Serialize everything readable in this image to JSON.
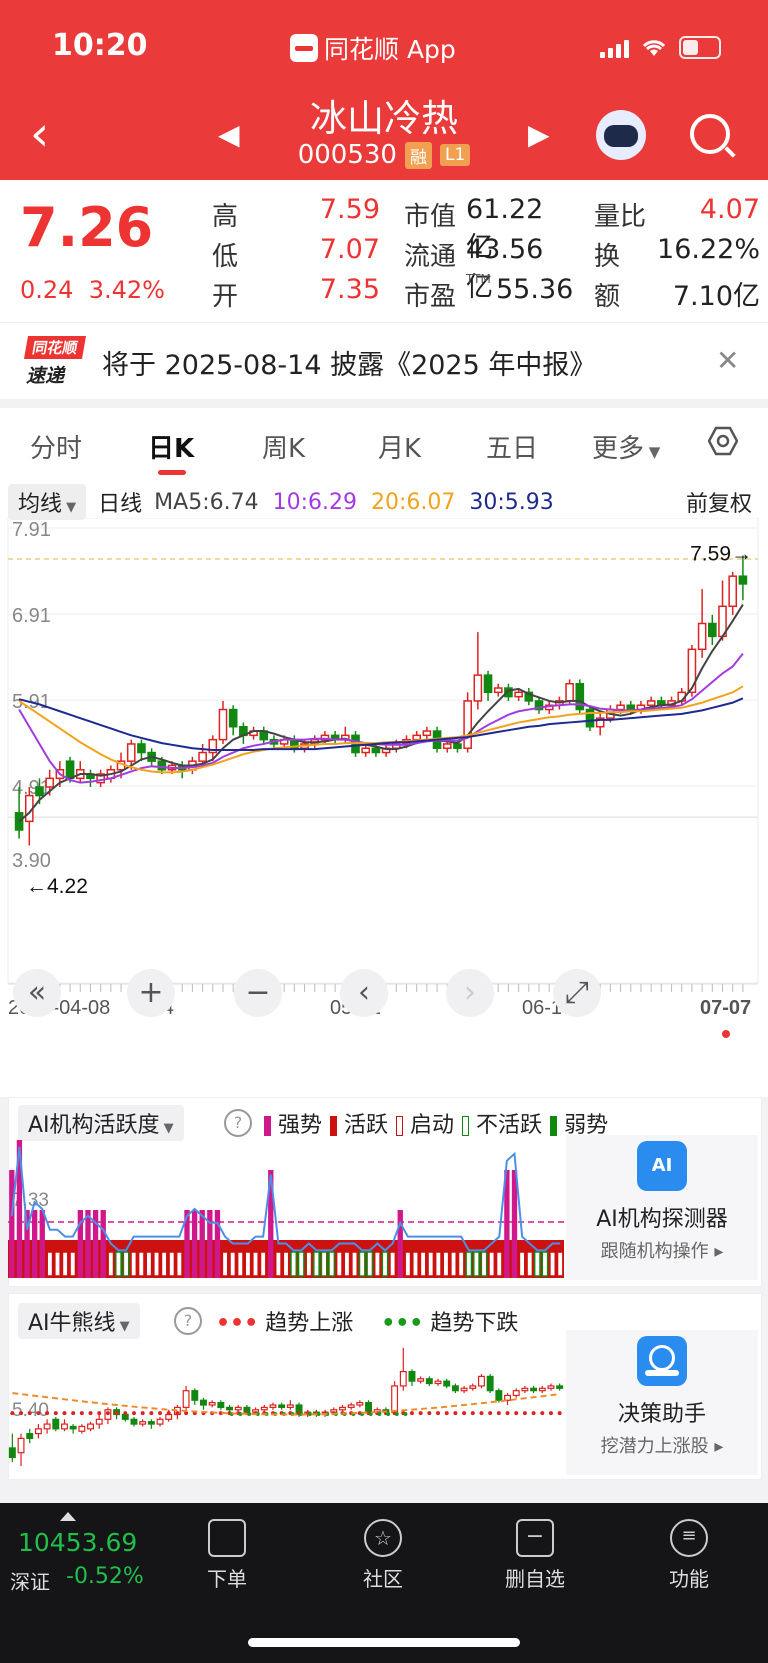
{
  "status_bar": {
    "time": "10:20",
    "app_label": "同花顺 App"
  },
  "header": {
    "name": "冰山冷热",
    "code": "000530",
    "tag_rong": "融",
    "tag_level": "L1"
  },
  "quote": {
    "price": "7.26",
    "change_abs": "0.24",
    "change_pct": "3.42%",
    "high_label": "高",
    "high": "7.59",
    "low_label": "低",
    "low": "7.07",
    "open_label": "开",
    "open": "7.35",
    "mcap_label": "市值",
    "mcap": "61.22亿",
    "float_label": "流通",
    "float": "43.56亿",
    "pe_label": "市盈",
    "pe_sup": "TTM",
    "pe": "55.36",
    "vr_label": "量比",
    "vr": "4.07",
    "turnover_label": "换",
    "turnover": "16.22%",
    "amount_label": "额",
    "amount": "7.10亿"
  },
  "notice": {
    "logo_top": "同花顺",
    "logo_bottom": "速递",
    "text": "将于 2025-08-14 披露《2025 年中报》"
  },
  "tabs": [
    "分时",
    "日K",
    "周K",
    "月K",
    "五日",
    "更多"
  ],
  "ma_row": {
    "select": "均线",
    "period": "日线",
    "ma5": "MA5:6.74",
    "ma10": "10:6.29",
    "ma20": "20:6.07",
    "ma30": "30:5.93",
    "adjust": "前复权"
  },
  "chart_data": {
    "type": "candlestick",
    "y_ticks": [
      "7.91",
      "6.91",
      "5.91",
      "4.91",
      "3.90"
    ],
    "high_marker": "7.59→",
    "low_marker": "←4.22",
    "x_ticks": [
      "2025-04-08",
      "-24",
      "05-21",
      "06-13",
      "07-07"
    ],
    "series": [
      {
        "name": "MA5",
        "color": "#444444"
      },
      {
        "name": "MA10",
        "color": "#a23be0"
      },
      {
        "name": "MA20",
        "color": "#f2a21b"
      },
      {
        "name": "MA30",
        "color": "#1f2a90"
      }
    ],
    "candles": [
      [
        4.6,
        4.4,
        4.9,
        4.3
      ],
      [
        4.5,
        4.8,
        4.9,
        4.22
      ],
      [
        4.9,
        4.8,
        5.0,
        4.7
      ],
      [
        4.9,
        5.0,
        5.1,
        4.8
      ],
      [
        5.0,
        5.1,
        5.2,
        4.9
      ],
      [
        5.2,
        5.0,
        5.25,
        4.95
      ],
      [
        5.0,
        5.1,
        5.2,
        4.95
      ],
      [
        5.05,
        5.0,
        5.1,
        4.9
      ],
      [
        4.95,
        5.05,
        5.1,
        4.9
      ],
      [
        5.0,
        5.1,
        5.15,
        4.95
      ],
      [
        5.1,
        5.2,
        5.3,
        5.0
      ],
      [
        5.2,
        5.4,
        5.45,
        5.1
      ],
      [
        5.4,
        5.3,
        5.45,
        5.2
      ],
      [
        5.3,
        5.2,
        5.35,
        5.15
      ],
      [
        5.2,
        5.1,
        5.25,
        5.05
      ],
      [
        5.1,
        5.15,
        5.2,
        5.05
      ],
      [
        5.15,
        5.1,
        5.2,
        5.0
      ],
      [
        5.1,
        5.2,
        5.25,
        5.05
      ],
      [
        5.2,
        5.3,
        5.4,
        5.15
      ],
      [
        5.3,
        5.45,
        5.5,
        5.2
      ],
      [
        5.45,
        5.8,
        5.9,
        5.4
      ],
      [
        5.8,
        5.6,
        5.85,
        5.5
      ],
      [
        5.6,
        5.5,
        5.65,
        5.4
      ],
      [
        5.5,
        5.55,
        5.6,
        5.45
      ],
      [
        5.55,
        5.45,
        5.6,
        5.4
      ],
      [
        5.45,
        5.4,
        5.5,
        5.35
      ],
      [
        5.4,
        5.45,
        5.5,
        5.35
      ],
      [
        5.45,
        5.35,
        5.5,
        5.3
      ],
      [
        5.35,
        5.4,
        5.45,
        5.3
      ],
      [
        5.4,
        5.45,
        5.5,
        5.35
      ],
      [
        5.45,
        5.5,
        5.55,
        5.4
      ],
      [
        5.5,
        5.45,
        5.55,
        5.4
      ],
      [
        5.45,
        5.5,
        5.6,
        5.4
      ],
      [
        5.5,
        5.3,
        5.55,
        5.25
      ],
      [
        5.3,
        5.35,
        5.4,
        5.25
      ],
      [
        5.35,
        5.3,
        5.4,
        5.25
      ],
      [
        5.3,
        5.35,
        5.4,
        5.25
      ],
      [
        5.35,
        5.4,
        5.45,
        5.3
      ],
      [
        5.4,
        5.45,
        5.5,
        5.35
      ],
      [
        5.45,
        5.5,
        5.55,
        5.4
      ],
      [
        5.5,
        5.55,
        5.6,
        5.45
      ],
      [
        5.55,
        5.35,
        5.6,
        5.3
      ],
      [
        5.35,
        5.4,
        5.45,
        5.3
      ],
      [
        5.4,
        5.35,
        5.45,
        5.3
      ],
      [
        5.35,
        5.9,
        6.0,
        5.3
      ],
      [
        5.9,
        6.2,
        6.7,
        5.8
      ],
      [
        6.2,
        6.0,
        6.25,
        5.9
      ],
      [
        6.0,
        6.05,
        6.1,
        5.95
      ],
      [
        6.05,
        5.95,
        6.1,
        5.9
      ],
      [
        5.95,
        6.0,
        6.05,
        5.9
      ],
      [
        6.0,
        5.9,
        6.05,
        5.85
      ],
      [
        5.9,
        5.8,
        5.95,
        5.75
      ],
      [
        5.8,
        5.85,
        5.9,
        5.75
      ],
      [
        5.85,
        5.9,
        5.95,
        5.8
      ],
      [
        5.9,
        6.1,
        6.15,
        5.85
      ],
      [
        6.1,
        5.8,
        6.15,
        5.75
      ],
      [
        5.8,
        5.6,
        5.85,
        5.55
      ],
      [
        5.6,
        5.7,
        5.75,
        5.5
      ],
      [
        5.7,
        5.8,
        5.85,
        5.65
      ],
      [
        5.8,
        5.85,
        5.9,
        5.75
      ],
      [
        5.85,
        5.8,
        5.9,
        5.75
      ],
      [
        5.8,
        5.85,
        5.9,
        5.75
      ],
      [
        5.85,
        5.9,
        5.95,
        5.8
      ],
      [
        5.9,
        5.85,
        5.95,
        5.8
      ],
      [
        5.85,
        5.9,
        5.95,
        5.8
      ],
      [
        5.9,
        6.0,
        6.05,
        5.85
      ],
      [
        6.0,
        6.5,
        6.55,
        5.95
      ],
      [
        6.5,
        6.8,
        7.2,
        6.4
      ],
      [
        6.8,
        6.65,
        6.9,
        6.55
      ],
      [
        6.65,
        7.0,
        7.3,
        6.6
      ],
      [
        7.0,
        7.35,
        7.4,
        6.9
      ],
      [
        7.35,
        7.26,
        7.59,
        7.07
      ]
    ],
    "ma5": [
      4.5,
      4.6,
      4.75,
      4.85,
      4.95,
      5.0,
      5.05,
      5.05,
      5.03,
      5.05,
      5.08,
      5.15,
      5.22,
      5.25,
      5.22,
      5.18,
      5.15,
      5.15,
      5.17,
      5.22,
      5.35,
      5.45,
      5.5,
      5.55,
      5.55,
      5.52,
      5.48,
      5.45,
      5.42,
      5.42,
      5.43,
      5.45,
      5.46,
      5.42,
      5.39,
      5.37,
      5.34,
      5.34,
      5.37,
      5.41,
      5.45,
      5.44,
      5.43,
      5.41,
      5.5,
      5.65,
      5.78,
      5.9,
      6.02,
      6.04,
      5.98,
      5.94,
      5.9,
      5.88,
      5.9,
      5.9,
      5.83,
      5.78,
      5.75,
      5.73,
      5.75,
      5.8,
      5.83,
      5.85,
      5.86,
      5.9,
      6.05,
      6.28,
      6.48,
      6.65,
      6.83,
      7.02
    ],
    "ma10": [
      5.8,
      5.6,
      5.4,
      5.2,
      5.05,
      4.98,
      4.95,
      4.96,
      4.98,
      5.0,
      5.04,
      5.08,
      5.12,
      5.14,
      5.13,
      5.12,
      5.12,
      5.13,
      5.15,
      5.18,
      5.25,
      5.3,
      5.35,
      5.38,
      5.4,
      5.43,
      5.45,
      5.45,
      5.45,
      5.46,
      5.46,
      5.45,
      5.45,
      5.43,
      5.41,
      5.4,
      5.39,
      5.39,
      5.39,
      5.41,
      5.43,
      5.44,
      5.44,
      5.44,
      5.47,
      5.55,
      5.62,
      5.68,
      5.74,
      5.78,
      5.8,
      5.82,
      5.84,
      5.85,
      5.86,
      5.86,
      5.84,
      5.81,
      5.8,
      5.79,
      5.79,
      5.8,
      5.81,
      5.82,
      5.83,
      5.85,
      5.92,
      6.02,
      6.12,
      6.22,
      6.3,
      6.45
    ],
    "ma20": [
      5.9,
      5.82,
      5.74,
      5.66,
      5.58,
      5.5,
      5.42,
      5.35,
      5.28,
      5.22,
      5.17,
      5.13,
      5.1,
      5.08,
      5.07,
      5.07,
      5.08,
      5.1,
      5.13,
      5.16,
      5.2,
      5.24,
      5.28,
      5.31,
      5.33,
      5.35,
      5.36,
      5.37,
      5.38,
      5.39,
      5.4,
      5.4,
      5.41,
      5.41,
      5.41,
      5.41,
      5.42,
      5.42,
      5.43,
      5.44,
      5.45,
      5.46,
      5.47,
      5.48,
      5.5,
      5.53,
      5.56,
      5.59,
      5.62,
      5.65,
      5.67,
      5.69,
      5.71,
      5.72,
      5.74,
      5.75,
      5.76,
      5.76,
      5.77,
      5.77,
      5.78,
      5.78,
      5.79,
      5.8,
      5.81,
      5.82,
      5.85,
      5.88,
      5.92,
      5.96,
      6.0,
      6.07
    ],
    "ma30": [
      5.92,
      5.89,
      5.86,
      5.82,
      5.78,
      5.74,
      5.7,
      5.66,
      5.62,
      5.58,
      5.54,
      5.5,
      5.47,
      5.44,
      5.41,
      5.39,
      5.37,
      5.35,
      5.34,
      5.33,
      5.33,
      5.33,
      5.33,
      5.33,
      5.34,
      5.34,
      5.34,
      5.34,
      5.34,
      5.34,
      5.35,
      5.36,
      5.37,
      5.38,
      5.39,
      5.4,
      5.41,
      5.42,
      5.42,
      5.43,
      5.44,
      5.45,
      5.46,
      5.47,
      5.48,
      5.5,
      5.52,
      5.54,
      5.56,
      5.58,
      5.6,
      5.61,
      5.63,
      5.64,
      5.65,
      5.66,
      5.67,
      5.68,
      5.68,
      5.69,
      5.7,
      5.71,
      5.72,
      5.73,
      5.74,
      5.75,
      5.77,
      5.79,
      5.82,
      5.85,
      5.88,
      5.93
    ]
  },
  "controls": [
    "«",
    "+",
    "−",
    "‹",
    "›",
    "⤢"
  ],
  "ai_activity": {
    "select": "AI机构活跃度",
    "legend": [
      "强势",
      "活跃",
      "启动",
      "不活跃",
      "弱势"
    ],
    "legend_colors": [
      "#d0188a",
      "#cc1111",
      "#cc1111",
      "#118811",
      "#118811"
    ],
    "level_label": "7.33",
    "bars": [
      3,
      4,
      2,
      2,
      2,
      1,
      1,
      1,
      1,
      2,
      2,
      2,
      2,
      1,
      0,
      0,
      1,
      1,
      1,
      1,
      1,
      1,
      1,
      2,
      2,
      2,
      2,
      2,
      1,
      1,
      1,
      1,
      1,
      1,
      3,
      1,
      1,
      0,
      0,
      1,
      0,
      0,
      0,
      1,
      1,
      1,
      0,
      0,
      1,
      0,
      1,
      2,
      1,
      1,
      1,
      1,
      1,
      1,
      1,
      1,
      0,
      0,
      0,
      1,
      1,
      3,
      3,
      1,
      1,
      0,
      0,
      1,
      1
    ],
    "line": [
      0.45,
      0.95,
      0.35,
      0.55,
      0.5,
      0.35,
      0.35,
      0.3,
      0.3,
      0.4,
      0.45,
      0.4,
      0.35,
      0.25,
      0.2,
      0.2,
      0.3,
      0.3,
      0.3,
      0.3,
      0.3,
      0.3,
      0.3,
      0.45,
      0.5,
      0.45,
      0.4,
      0.4,
      0.3,
      0.25,
      0.25,
      0.25,
      0.3,
      0.3,
      0.75,
      0.25,
      0.25,
      0.2,
      0.2,
      0.25,
      0.2,
      0.2,
      0.2,
      0.25,
      0.25,
      0.25,
      0.2,
      0.2,
      0.25,
      0.2,
      0.25,
      0.4,
      0.3,
      0.3,
      0.3,
      0.3,
      0.3,
      0.3,
      0.3,
      0.3,
      0.2,
      0.2,
      0.2,
      0.25,
      0.3,
      0.85,
      0.9,
      0.3,
      0.25,
      0.2,
      0.2,
      0.25,
      0.25
    ],
    "card_title": "AI机构探测器",
    "card_sub": "跟随机构操作 ▸",
    "card_icon_text": "AI"
  },
  "ai_bull": {
    "select": "AI牛熊线",
    "legend_up_mark": "•••",
    "legend_up": "趋势上涨",
    "legend_down_mark": "•••",
    "legend_down": "趋势下跌",
    "level_label": "5.40",
    "card_title": "决策助手",
    "card_sub": "挖潜力上涨股 ▸"
  },
  "bottom_nav": {
    "index_value": "10453.69",
    "index_name": "深证",
    "index_change": "-0.52%",
    "items": [
      "下单",
      "社区",
      "删自选",
      "功能"
    ]
  }
}
